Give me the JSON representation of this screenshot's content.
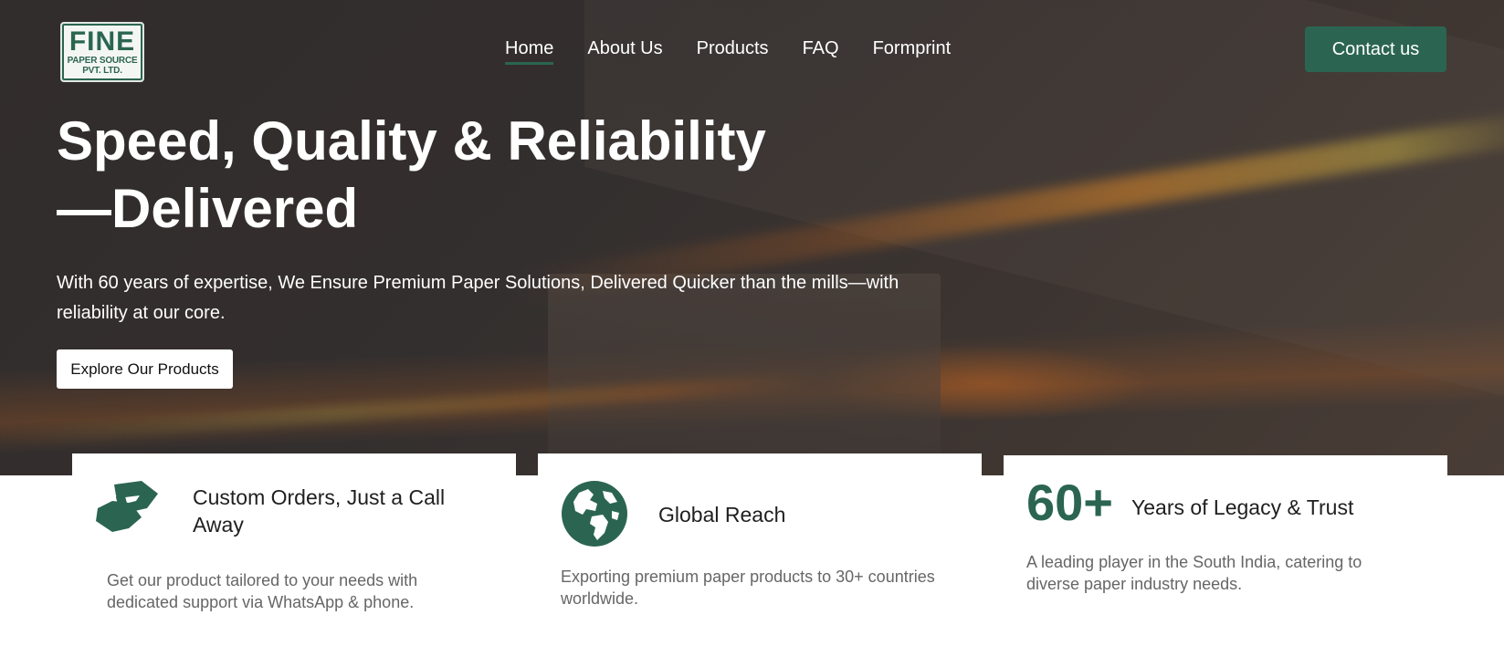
{
  "logo": {
    "main": "FINE",
    "line1": "PAPER SOURCE",
    "line2": "PVT. LTD."
  },
  "nav": {
    "items": [
      {
        "label": "Home",
        "active": true
      },
      {
        "label": "About Us"
      },
      {
        "label": "Products"
      },
      {
        "label": "FAQ"
      },
      {
        "label": "Formprint"
      }
    ],
    "contact_label": "Contact us"
  },
  "hero": {
    "title_line1": "Speed, Quality & Reliability",
    "title_line2": "—Delivered",
    "subtitle": "With 60 years of expertise, We Ensure Premium Paper Solutions, Delivered Quicker than the mills—with reliability at our core.",
    "cta_label": "Explore Our Products"
  },
  "features": [
    {
      "icon": "handshake-icon",
      "title": "Custom Orders, Just a Call Away",
      "description": "Get our product tailored to your needs with dedicated support via WhatsApp & phone."
    },
    {
      "icon": "globe-icon",
      "title": "Global Reach",
      "description": "Exporting premium paper products to 30+ countries worldwide."
    },
    {
      "stat": "60+",
      "title": "Years of Legacy & Trust",
      "description": "A leading player in the South India, catering to diverse paper industry needs."
    }
  ],
  "colors": {
    "brand_green": "#2b6552",
    "hero_overlay": "#3a3433"
  }
}
